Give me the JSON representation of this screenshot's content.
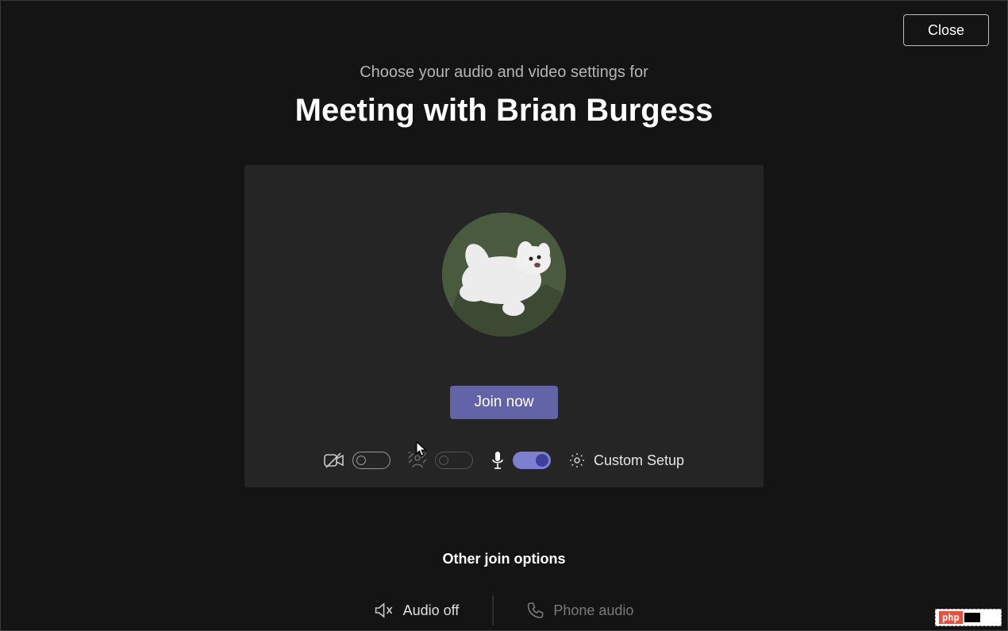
{
  "close_label": "Close",
  "header": {
    "subtitle": "Choose your audio and video settings for",
    "title": "Meeting with Brian Burgess"
  },
  "join_label": "Join now",
  "controls": {
    "camera_on": false,
    "blur_on": false,
    "mic_on": true,
    "setup_label": "Custom Setup"
  },
  "other_options": {
    "heading": "Other join options",
    "audio_off_label": "Audio off",
    "phone_audio_label": "Phone audio"
  },
  "watermark": "php"
}
